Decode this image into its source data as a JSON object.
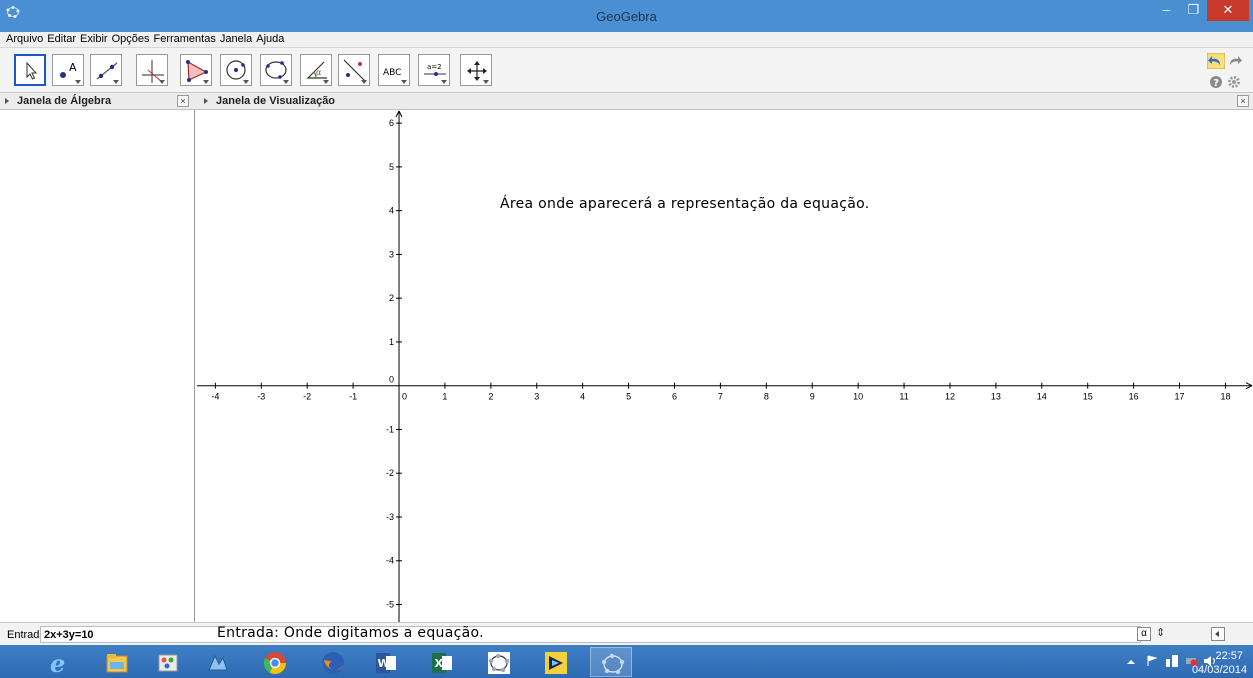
{
  "window": {
    "title": "GeoGebra",
    "minimize": "–",
    "maximize": "❐",
    "close": "✕"
  },
  "menu": [
    "Arquivo",
    "Editar",
    "Exibir",
    "Opções",
    "Ferramentas",
    "Janela",
    "Ajuda"
  ],
  "toolbar": {
    "tools": [
      {
        "name": "move-tool",
        "icon": "arrow-cursor-icon"
      },
      {
        "name": "point-tool",
        "icon": "point-icon",
        "label": "A"
      },
      {
        "name": "line-tool",
        "icon": "line-icon"
      },
      {
        "name": "perpendicular-line-tool",
        "icon": "perpendicular-icon"
      },
      {
        "name": "polygon-tool",
        "icon": "polygon-icon"
      },
      {
        "name": "circle-tool",
        "icon": "circle-icon"
      },
      {
        "name": "conic-tool",
        "icon": "ellipse-icon"
      },
      {
        "name": "angle-tool",
        "icon": "angle-icon"
      },
      {
        "name": "reflect-tool",
        "icon": "reflect-icon"
      },
      {
        "name": "text-tool",
        "icon": "text-icon",
        "label": "ABC"
      },
      {
        "name": "slider-tool",
        "icon": "slider-icon",
        "label": "a=2"
      },
      {
        "name": "move-graphics-view-tool",
        "icon": "move-view-icon"
      }
    ],
    "undo_icon": "undo-icon",
    "redo_icon": "redo-icon",
    "help_icon": "help-icon",
    "settings_icon": "gear-icon"
  },
  "panels": {
    "algebra_title": "Janela de Álgebra",
    "graphics_title": "Janela de Visualização",
    "close_glyph": "×"
  },
  "graphics": {
    "annotation": "Área onde aparecerá a representação da equação.",
    "x_ticks": [
      -4,
      -3,
      -2,
      -1,
      0,
      1,
      2,
      3,
      4,
      5,
      6,
      7,
      8,
      9,
      10,
      11,
      12,
      13,
      14,
      15,
      16,
      17,
      18
    ],
    "y_ticks": [
      -5,
      -4,
      -3,
      -2,
      -1,
      1,
      2,
      3,
      4,
      5,
      6
    ],
    "origin_label": "0",
    "x_range": [
      -4.4,
      18.6
    ],
    "y_range": [
      -5.4,
      6.3
    ]
  },
  "inputbar": {
    "label": "Entrada:",
    "value": "2x+3y=10",
    "annotation": "Entrada: Onde digitamos a equação.",
    "alpha_button": "α",
    "sort_button": "⇕"
  },
  "taskbar": {
    "apps": [
      "internet-explorer-icon",
      "file-explorer-icon",
      "paint-icon",
      "app-icon",
      "chrome-icon",
      "firefox-icon",
      "word-icon",
      "excel-icon",
      "geogebra-icon",
      "app-icon-2",
      "geogebra-active-icon"
    ],
    "time": "22:57",
    "date": "04/03/2014"
  },
  "colors": {
    "titlebar": "#4a8fd2",
    "taskbar": "#3a76bd",
    "selected_tool_border": "#1e56c8"
  }
}
